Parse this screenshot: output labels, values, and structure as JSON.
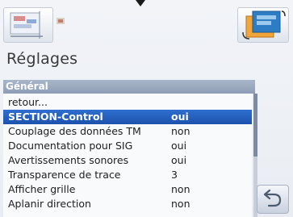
{
  "header": {
    "title": "Réglages",
    "left_button_icon": "map-settings-icon",
    "right_button_icon": "layers-icon",
    "flag_icon": "flag-icon"
  },
  "section": {
    "label": "Général"
  },
  "list": {
    "rows": [
      {
        "label": "retour...",
        "value": ""
      },
      {
        "label": "SECTION-Control",
        "value": "oui"
      },
      {
        "label": "Couplage des données TM",
        "value": "non"
      },
      {
        "label": "Documentation pour SIG",
        "value": "oui"
      },
      {
        "label": "Avertissements sonores",
        "value": "oui"
      },
      {
        "label": "Transparence de trace",
        "value": "3"
      },
      {
        "label": "Afficher grille",
        "value": "non"
      },
      {
        "label": "Aplanir direction",
        "value": "non"
      }
    ]
  },
  "footer": {
    "back_icon": "back-arrow-icon"
  },
  "colors": {
    "selection": "#1c52ad",
    "section_header": "#8d9db5"
  }
}
